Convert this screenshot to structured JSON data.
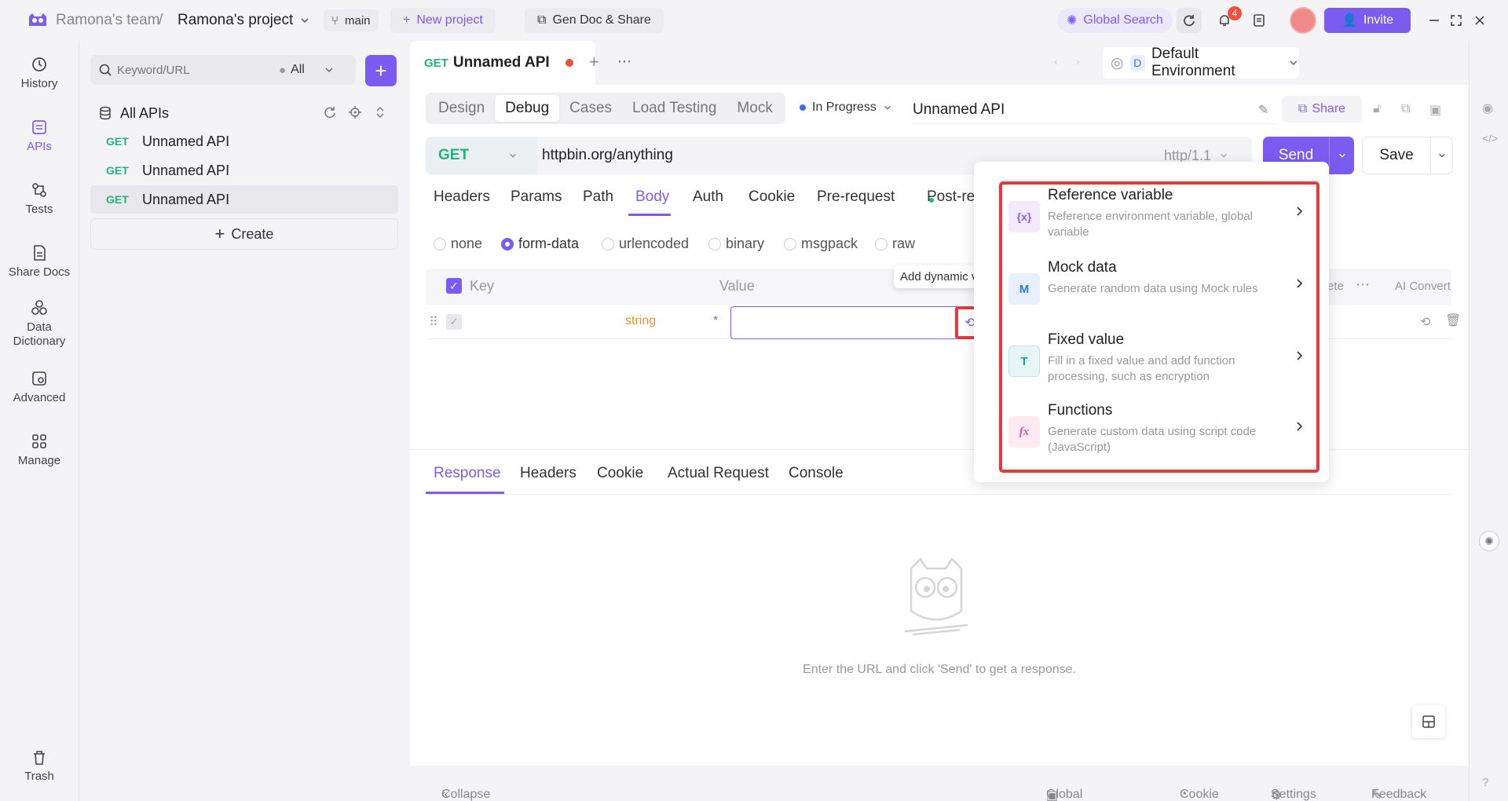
{
  "header": {
    "team": "Ramona's team",
    "separator": "/",
    "project": "Ramona's project",
    "branch": "main",
    "new_project": "New project",
    "gen_doc": "Gen Doc & Share",
    "global_search": "Global Search",
    "notification_count": "4",
    "invite": "Invite"
  },
  "nav": {
    "history": "History",
    "apis": "APIs",
    "tests": "Tests",
    "share_docs": "Share Docs",
    "data_dictionary": "Data Dictionary",
    "advanced": "Advanced",
    "manage": "Manage",
    "trash": "Trash"
  },
  "sidebar": {
    "search_placeholder": "Keyword/URL",
    "filter": "All",
    "all_apis": "All APIs",
    "items": [
      {
        "method": "GET",
        "name": "Unnamed API"
      },
      {
        "method": "GET",
        "name": "Unnamed API"
      },
      {
        "method": "GET",
        "name": "Unnamed API"
      }
    ],
    "create": "Create"
  },
  "tab": {
    "method": "GET",
    "title": "Unnamed API"
  },
  "environment": {
    "badge": "D",
    "name": "Default Environment"
  },
  "modes": [
    "Design",
    "Debug",
    "Cases",
    "Load Testing",
    "Mock"
  ],
  "status": "In Progress",
  "api_name": "Unnamed API",
  "share": "Share",
  "request": {
    "method": "GET",
    "url": "httpbin.org/anything",
    "protocol": "http/1.1",
    "send": "Send",
    "save": "Save"
  },
  "request_tabs": [
    "Headers",
    "Params",
    "Path",
    "Body",
    "Auth",
    "Cookie",
    "Pre-request",
    "Post-re"
  ],
  "body_types": [
    "none",
    "form-data",
    "urlencoded",
    "binary",
    "msgpack",
    "raw"
  ],
  "table": {
    "key_header": "Key",
    "value_header": "Value",
    "delete_partial": "ete",
    "ai_convert": "AI Convert",
    "row_type": "string",
    "required_mark": "*"
  },
  "tooltip": "Add dynamic value",
  "menu": {
    "items": [
      {
        "title": "Reference variable",
        "desc": "Reference environment variable, global variable",
        "icon_text": "{x}",
        "icon_color": "#8b5cf6"
      },
      {
        "title": "Mock data",
        "desc": "Generate random data using Mock rules",
        "icon_text": "M",
        "icon_color": "#2f7ae5"
      },
      {
        "title": "Fixed value",
        "desc": "Fill in a fixed value and add function processing, such as encryption",
        "icon_text": "T",
        "icon_color": "#1aa39a"
      },
      {
        "title": "Functions",
        "desc": "Generate custom data using script code (JavaScript)",
        "icon_text": "fx",
        "icon_color": "#e5569b"
      }
    ]
  },
  "response_tabs": [
    "Response",
    "Headers",
    "Cookie",
    "Actual Request",
    "Console"
  ],
  "response_empty": "Enter the URL and click 'Send' to get a response.",
  "footer": {
    "collapse": "Collapse Sidebar",
    "global_params": "Global Params",
    "cookie": "Cookie",
    "settings": "Settings",
    "feedback": "Feedback"
  },
  "colors": {
    "accent": "#7b5cf0",
    "get": "#21b37c",
    "highlight": "#e8383d"
  }
}
